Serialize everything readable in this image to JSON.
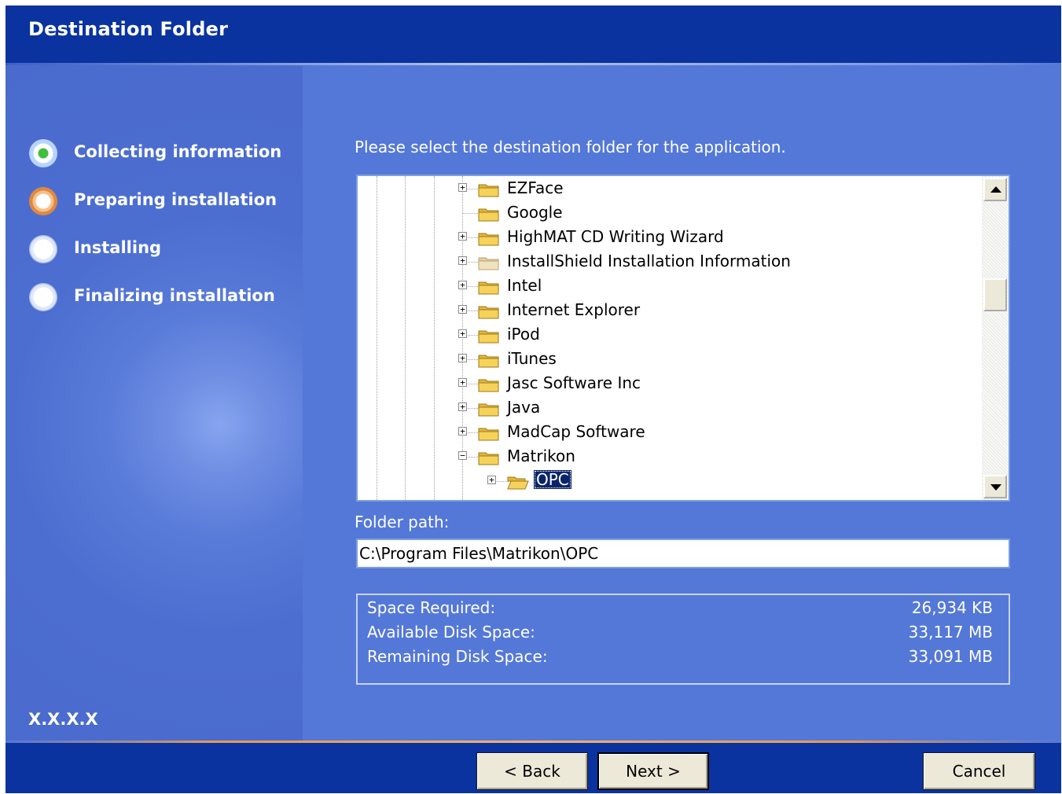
{
  "window": {
    "title": "Destination Folder"
  },
  "steps": [
    {
      "label": "Collecting information",
      "state": "active"
    },
    {
      "label": "Preparing installation",
      "state": "next"
    },
    {
      "label": "Installing",
      "state": "pending"
    },
    {
      "label": "Finalizing installation",
      "state": "pending"
    }
  ],
  "version": "X.X.X.X",
  "prompt": "Please select the destination folder for the application.",
  "tree": {
    "items": [
      {
        "label": "EZFace",
        "expandable": true,
        "expanded": false
      },
      {
        "label": "Google",
        "expandable": false,
        "expanded": false
      },
      {
        "label": "HighMAT CD Writing Wizard",
        "expandable": true,
        "expanded": false
      },
      {
        "label": "InstallShield Installation Information",
        "expandable": true,
        "expanded": false
      },
      {
        "label": "Intel",
        "expandable": true,
        "expanded": false
      },
      {
        "label": "Internet Explorer",
        "expandable": true,
        "expanded": false
      },
      {
        "label": "iPod",
        "expandable": true,
        "expanded": false
      },
      {
        "label": "iTunes",
        "expandable": true,
        "expanded": false
      },
      {
        "label": "Jasc Software Inc",
        "expandable": true,
        "expanded": false
      },
      {
        "label": "Java",
        "expandable": true,
        "expanded": false
      },
      {
        "label": "MadCap Software",
        "expandable": true,
        "expanded": false
      },
      {
        "label": "Matrikon",
        "expandable": true,
        "expanded": true
      },
      {
        "label": "OPC",
        "expandable": true,
        "expanded": false,
        "selected": true,
        "child": true
      }
    ]
  },
  "folder_path": {
    "label": "Folder path:",
    "value": "C:\\Program Files\\Matrikon\\OPC"
  },
  "space": {
    "required_label": "Space Required:",
    "required_value": "26,934 KB",
    "available_label": "Available Disk Space:",
    "available_value": "33,117 MB",
    "remaining_label": "Remaining Disk Space:",
    "remaining_value": "33,091 MB"
  },
  "buttons": {
    "back": "< Back",
    "next": "Next >",
    "cancel": "Cancel"
  },
  "colors": {
    "header": "#0a33a0",
    "body": "#5478d8",
    "selection": "#0a246a",
    "button_face": "#ece9d8"
  }
}
